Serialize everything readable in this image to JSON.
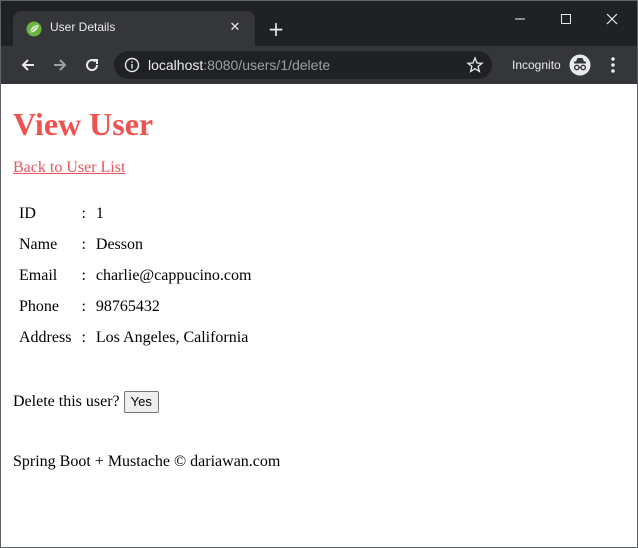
{
  "browser": {
    "tab_title": "User Details",
    "url_host": "localhost",
    "url_rest": ":8080/users/1/delete",
    "incognito_label": "Incognito"
  },
  "page": {
    "title": "View User",
    "back_link": "Back to User List",
    "fields": [
      {
        "label": "ID",
        "sep": ":",
        "value": "1"
      },
      {
        "label": "Name",
        "sep": ":",
        "value": "Desson"
      },
      {
        "label": "Email",
        "sep": ":",
        "value": "charlie@cappucino.com"
      },
      {
        "label": "Phone",
        "sep": ":",
        "value": "98765432"
      },
      {
        "label": "Address",
        "sep": ":",
        "value": "Los Angeles, California"
      }
    ],
    "delete_prompt": "Delete this user?",
    "yes_button": "Yes",
    "footer": "Spring Boot + Mustache © dariawan.com"
  },
  "colors": {
    "accent": "#ef5350",
    "link": "#e9545a"
  }
}
